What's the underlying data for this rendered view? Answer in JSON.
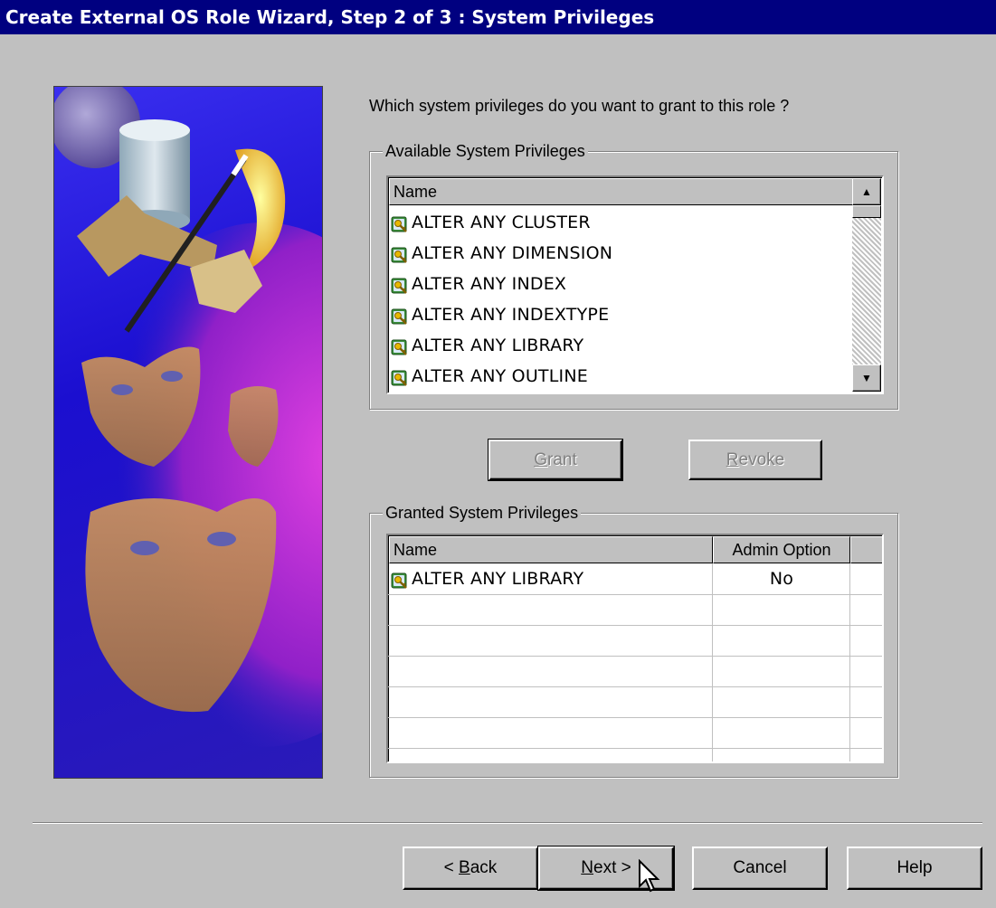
{
  "window": {
    "title": "Create External OS Role Wizard, Step 2 of 3 : System Privileges"
  },
  "prompt": "Which system privileges do you want to grant to this role ?",
  "available": {
    "group_label": "Available System Privileges",
    "column_name": "Name",
    "items": [
      "ALTER ANY CLUSTER",
      "ALTER ANY DIMENSION",
      "ALTER ANY INDEX",
      "ALTER ANY INDEXTYPE",
      "ALTER ANY LIBRARY",
      "ALTER ANY OUTLINE"
    ]
  },
  "actions": {
    "grant_label_pre": "",
    "grant_label_acc": "G",
    "grant_label_post": "rant",
    "revoke_label_pre": "",
    "revoke_label_acc": "R",
    "revoke_label_post": "evoke"
  },
  "granted": {
    "group_label": "Granted System Privileges",
    "column_name": "Name",
    "column_admin": "Admin Option",
    "rows": [
      {
        "name": "ALTER ANY LIBRARY",
        "admin": "No"
      }
    ]
  },
  "footer": {
    "back_pre": "< ",
    "back_acc": "B",
    "back_post": "ack",
    "next_pre": "",
    "next_acc": "N",
    "next_post": "ext >",
    "cancel": "Cancel",
    "help": "Help"
  },
  "icons": {
    "privilege": "privilege-key-icon",
    "scroll_up": "scroll-up-arrow-icon",
    "scroll_down": "scroll-down-arrow-icon",
    "cursor": "mouse-pointer-icon"
  },
  "colors": {
    "title_bar": "#000080",
    "dialog_bg": "#c0c0c0"
  }
}
